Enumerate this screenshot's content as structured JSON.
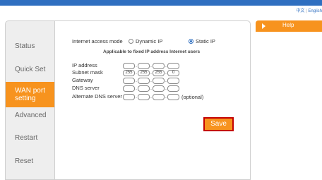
{
  "languages": {
    "chinese": "中文",
    "separator": "|",
    "english": "English"
  },
  "nav": {
    "items": [
      {
        "label": "Status"
      },
      {
        "label": "Quick Set"
      },
      {
        "label": "WAN port setting",
        "line1": "WAN port",
        "line2": "setting"
      },
      {
        "label": "Advanced"
      },
      {
        "label": "Restart"
      },
      {
        "label": "Reset"
      }
    ],
    "active_index": 2
  },
  "form": {
    "mode_label": "Internet access mode",
    "mode_options": [
      "Dynamic IP",
      "Static IP"
    ],
    "mode_selected": "Static IP",
    "note": "Applicable to fixed IP address Internet users",
    "fields": [
      {
        "label": "IP address",
        "octets": [
          "",
          "",
          "",
          ""
        ]
      },
      {
        "label": "Subnet mask",
        "octets": [
          "255",
          "255",
          "255",
          "0"
        ]
      },
      {
        "label": "Gateway",
        "octets": [
          "",
          "",
          "",
          ""
        ]
      },
      {
        "label": "DNS server",
        "octets": [
          "",
          "",
          "",
          ""
        ]
      },
      {
        "label": "Alternate DNS server",
        "octets": [
          "",
          "",
          "",
          ""
        ],
        "suffix": "(optional)"
      }
    ],
    "save_label": "Save"
  },
  "help": {
    "label": "Help"
  },
  "colors": {
    "accent": "#f7931e",
    "topbar": "#2f6fc0",
    "save_border": "#c40000"
  }
}
